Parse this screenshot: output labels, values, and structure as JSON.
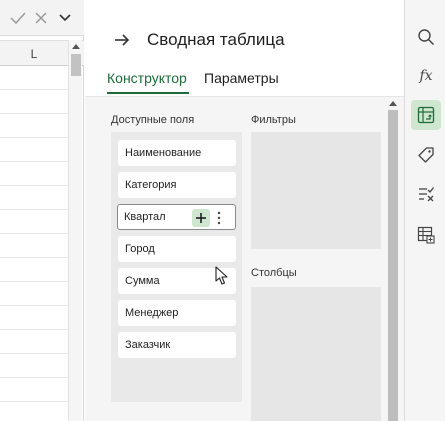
{
  "sheet": {
    "column_label": "L"
  },
  "pane": {
    "title": "Сводная таблица",
    "tabs": [
      {
        "label": "Конструктор",
        "active": true
      },
      {
        "label": "Параметры",
        "active": false
      }
    ],
    "sections": {
      "available_fields": "Доступные поля",
      "filters": "Фильтры",
      "columns": "Столбцы"
    },
    "fields": [
      {
        "label": "Наименование"
      },
      {
        "label": "Категория"
      },
      {
        "label": "Квартал",
        "hovered": true
      },
      {
        "label": "Город"
      },
      {
        "label": "Сумма"
      },
      {
        "label": "Менеджер"
      },
      {
        "label": "Заказчик"
      }
    ]
  },
  "rail": {
    "items": [
      {
        "icon": "search-icon"
      },
      {
        "icon": "function-icon",
        "text": "fx"
      },
      {
        "icon": "pivot-table-icon",
        "active": true
      },
      {
        "icon": "tag-icon"
      },
      {
        "icon": "checklist-icon"
      },
      {
        "icon": "table-settings-icon"
      }
    ]
  },
  "colors": {
    "accent": "#1d6b3a",
    "active_bg": "#cfe7cf"
  }
}
